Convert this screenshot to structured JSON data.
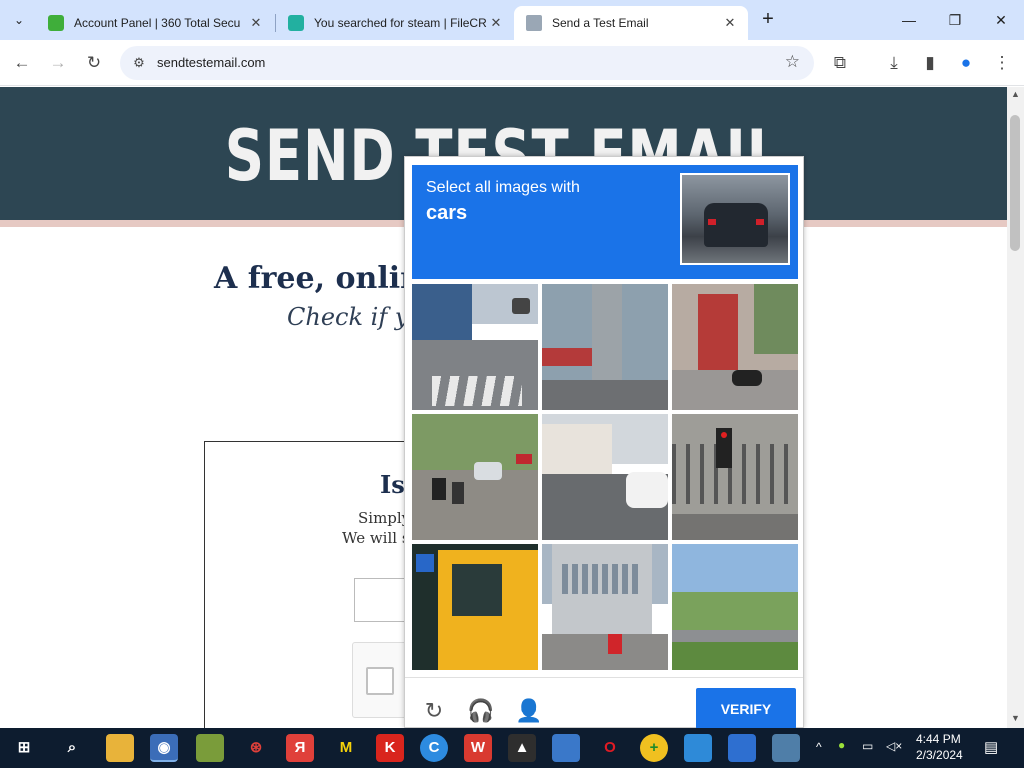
{
  "browser": {
    "tabs": [
      {
        "title": "Account Panel | 360 Total Secu",
        "favicon": "360-total-security-icon",
        "color": "#3fae3a"
      },
      {
        "title": "You searched for steam | FileCR",
        "favicon": "filecr-icon",
        "color": "#22b0a0"
      },
      {
        "title": "Send a Test Email",
        "favicon": "send-test-email-icon",
        "color": "#9aa7b5"
      }
    ],
    "close_glyph": "✕",
    "new_tab_glyph": "+",
    "url": "sendtestemail.com"
  },
  "page": {
    "hero_title": "SEND TEST EMAIL",
    "subtitle": "A free, onlin",
    "tagline": "Check if yo",
    "form_heading": "Is",
    "form_line1": "Simply",
    "form_line2": "We will s"
  },
  "captcha": {
    "prompt": "Select all images with",
    "target": "cars",
    "verify_label": "VERIFY",
    "reload_icon": "↻",
    "audio_icon": "🎧",
    "info_icon": "👤"
  },
  "colors": {
    "hero_bg": "#2d4653",
    "captcha_blue": "#1a73e8",
    "taskbar": "#0d1c2f"
  },
  "taskbar": {
    "time": "4:44 PM",
    "date": "2/3/2024"
  }
}
